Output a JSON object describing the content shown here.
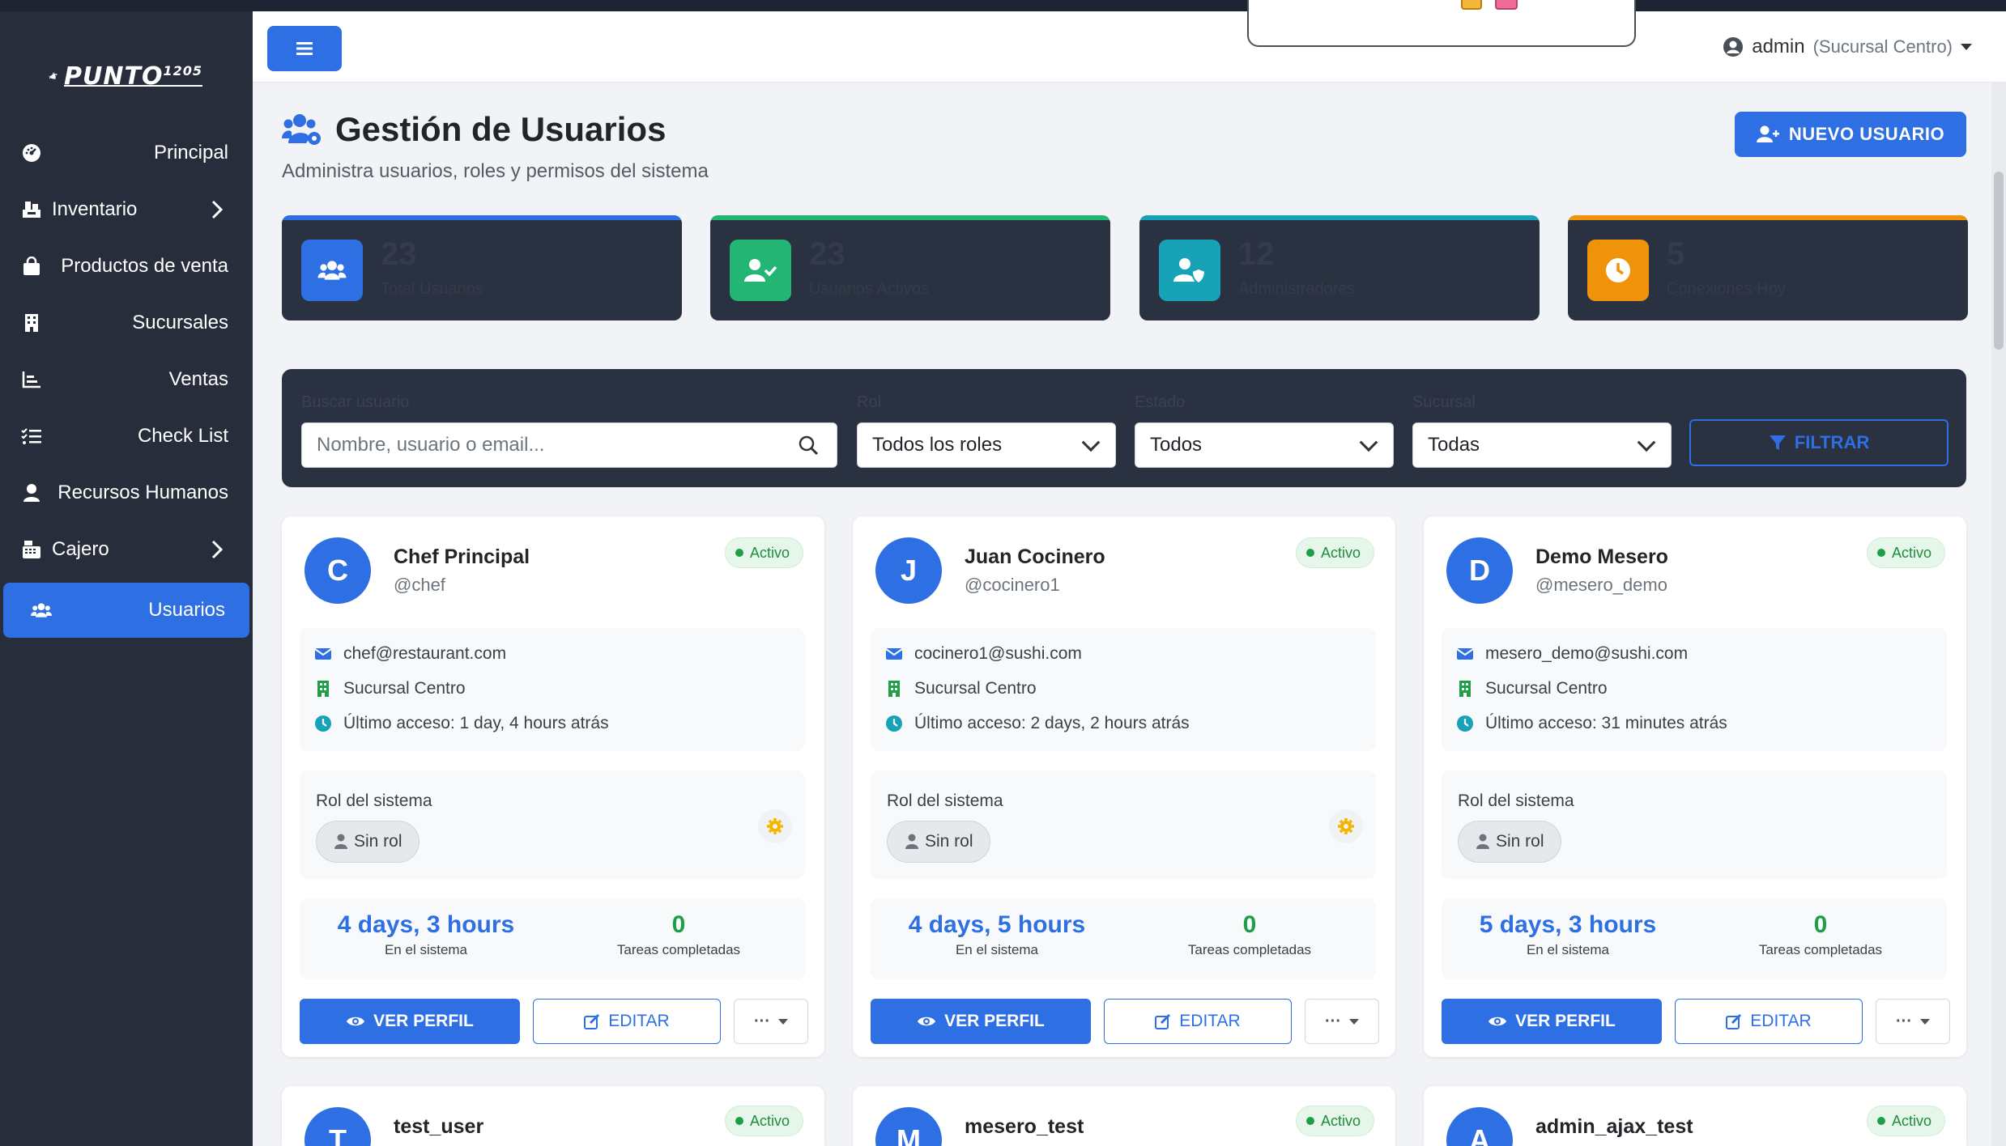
{
  "colors": {
    "primary": "#2f6fe4",
    "sidebar_bg": "#272d3b",
    "card_dark": "#2a3140",
    "success": "#1e9e46",
    "teal": "#17a2b8",
    "orange": "#f0920a",
    "green": "#22b573"
  },
  "sidebar": {
    "logo_text": "PUNTO",
    "logo_sup": "1205",
    "items": [
      {
        "label": "Principal",
        "icon": "dashboard-icon"
      },
      {
        "label": "Inventario",
        "icon": "inventory-icon"
      },
      {
        "label": "Productos de venta",
        "icon": "shopping-bag-icon"
      },
      {
        "label": "Sucursales",
        "icon": "building-icon"
      },
      {
        "label": "Ventas",
        "icon": "chart-icon"
      },
      {
        "label": "Check List",
        "icon": "checklist-icon"
      },
      {
        "label": "Recursos Humanos",
        "icon": "person-icon"
      },
      {
        "label": "Cajero",
        "icon": "cash-register-icon"
      },
      {
        "label": "Usuarios",
        "icon": "users-icon"
      }
    ]
  },
  "header": {
    "user": "admin",
    "branch": "(Sucursal Centro)"
  },
  "page": {
    "title": "Gestión de Usuarios",
    "subtitle": "Administra usuarios, roles y permisos del sistema",
    "new_user_label": "NUEVO USUARIO"
  },
  "stats": [
    {
      "value": "23",
      "label": "Total Usuarios",
      "icon": "users-icon"
    },
    {
      "value": "23",
      "label": "Usuarios Activos",
      "icon": "user-check-icon"
    },
    {
      "value": "12",
      "label": "Administradores",
      "icon": "user-shield-icon"
    },
    {
      "value": "5",
      "label": "Conexiones Hoy",
      "icon": "clock-icon"
    }
  ],
  "filters": {
    "search_label": "Buscar usuario",
    "search_placeholder": "Nombre, usuario o email...",
    "role_label": "Rol",
    "role_value": "Todos los roles",
    "status_label": "Estado",
    "status_value": "Todos",
    "branch_label": "Sucursal",
    "branch_value": "Todas",
    "filter_button": "FILTRAR"
  },
  "cards": [
    {
      "initial": "C",
      "name": "Chef Principal",
      "username": "@chef",
      "status": "Activo",
      "email": "chef@restaurant.com",
      "branch": "Sucursal Centro",
      "last_access": "Último acceso: 1 day, 4 hours atrás",
      "role_label": "Rol del sistema",
      "role": "Sin rol",
      "time": "4 days, 3 hours",
      "time_label": "En el sistema",
      "tasks": "0",
      "tasks_label": "Tareas completadas",
      "view": "VER PERFIL",
      "edit": "EDITAR",
      "more": "···"
    },
    {
      "initial": "J",
      "name": "Juan Cocinero",
      "username": "@cocinero1",
      "status": "Activo",
      "email": "cocinero1@sushi.com",
      "branch": "Sucursal Centro",
      "last_access": "Último acceso: 2 days, 2 hours atrás",
      "role_label": "Rol del sistema",
      "role": "Sin rol",
      "time": "4 days, 5 hours",
      "time_label": "En el sistema",
      "tasks": "0",
      "tasks_label": "Tareas completadas",
      "view": "VER PERFIL",
      "edit": "EDITAR",
      "more": "···"
    },
    {
      "initial": "D",
      "name": "Demo Mesero",
      "username": "@mesero_demo",
      "status": "Activo",
      "email": "mesero_demo@sushi.com",
      "branch": "Sucursal Centro",
      "last_access": "Último acceso: 31 minutes atrás",
      "role_label": "Rol del sistema",
      "role": "Sin rol",
      "time": "5 days, 3 hours",
      "time_label": "En el sistema",
      "tasks": "0",
      "tasks_label": "Tareas completadas",
      "view": "VER PERFIL",
      "edit": "EDITAR",
      "more": "···"
    },
    {
      "initial": "T",
      "name": "test_user",
      "status": "Activo"
    },
    {
      "initial": "M",
      "name": "mesero_test",
      "status": "Activo"
    },
    {
      "initial": "A",
      "name": "admin_ajax_test",
      "status": "Activo"
    }
  ]
}
